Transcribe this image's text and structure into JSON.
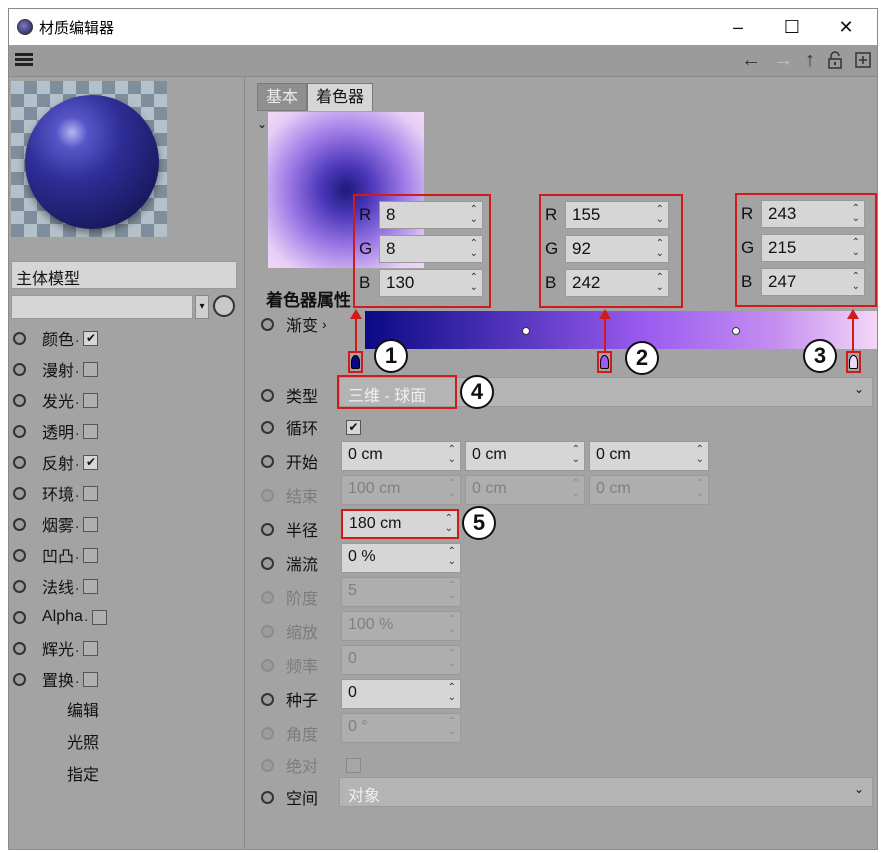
{
  "window": {
    "title": "材质编辑器",
    "minimize": "–",
    "maximize": "☐",
    "close": "✕"
  },
  "toolbar": {
    "back": "←",
    "forward": "→",
    "up": "↑",
    "lock": "🔒",
    "newwin": "⊞"
  },
  "left": {
    "material_name": "主体模型",
    "channels": [
      {
        "label": "颜色",
        "checked": true
      },
      {
        "label": "漫射",
        "checked": false
      },
      {
        "label": "发光",
        "checked": false
      },
      {
        "label": "透明",
        "checked": false
      },
      {
        "label": "反射",
        "checked": true
      },
      {
        "label": "环境",
        "checked": false
      },
      {
        "label": "烟雾",
        "checked": false
      },
      {
        "label": "凹凸",
        "checked": false
      },
      {
        "label": "法线",
        "checked": false
      },
      {
        "label": "Alpha",
        "checked": false
      },
      {
        "label": "辉光",
        "checked": false
      },
      {
        "label": "置换",
        "checked": false
      }
    ],
    "extra": [
      "编辑",
      "光照",
      "指定"
    ]
  },
  "tabs": [
    "基本",
    "着色器"
  ],
  "section_title": "着色器属性",
  "rgb": [
    {
      "R": "8",
      "G": "8",
      "B": "130"
    },
    {
      "R": "155",
      "G": "92",
      "B": "242"
    },
    {
      "R": "243",
      "G": "215",
      "B": "247"
    }
  ],
  "rgb_labels": [
    "R",
    "G",
    "B"
  ],
  "gradient": {
    "label": "渐变",
    "arrow": "›",
    "stop_colors": [
      "#080882",
      "#9b5cf2",
      "#f3d7f7"
    ]
  },
  "callouts": [
    "1",
    "2",
    "3",
    "4",
    "5"
  ],
  "props": {
    "type": {
      "label": "类型",
      "value": "三维 - 球面"
    },
    "cycle": {
      "label": "循环",
      "checked": true
    },
    "start": {
      "label": "开始",
      "v1": "0 cm",
      "v2": "0 cm",
      "v3": "0 cm"
    },
    "end": {
      "label": "结束",
      "v1": "100 cm",
      "v2": "0 cm",
      "v3": "0 cm"
    },
    "radius": {
      "label": "半径",
      "value": "180 cm"
    },
    "turbulence": {
      "label": "湍流",
      "value": "0 %"
    },
    "octaves": {
      "label": "阶度",
      "value": "5"
    },
    "scale": {
      "label": "缩放",
      "value": "100 %"
    },
    "frequency": {
      "label": "频率",
      "value": "0"
    },
    "seed": {
      "label": "种子",
      "value": "0"
    },
    "angle": {
      "label": "角度",
      "value": "0 °"
    },
    "absolute": {
      "label": "绝对"
    },
    "space": {
      "label": "空间",
      "value": "对象"
    }
  }
}
